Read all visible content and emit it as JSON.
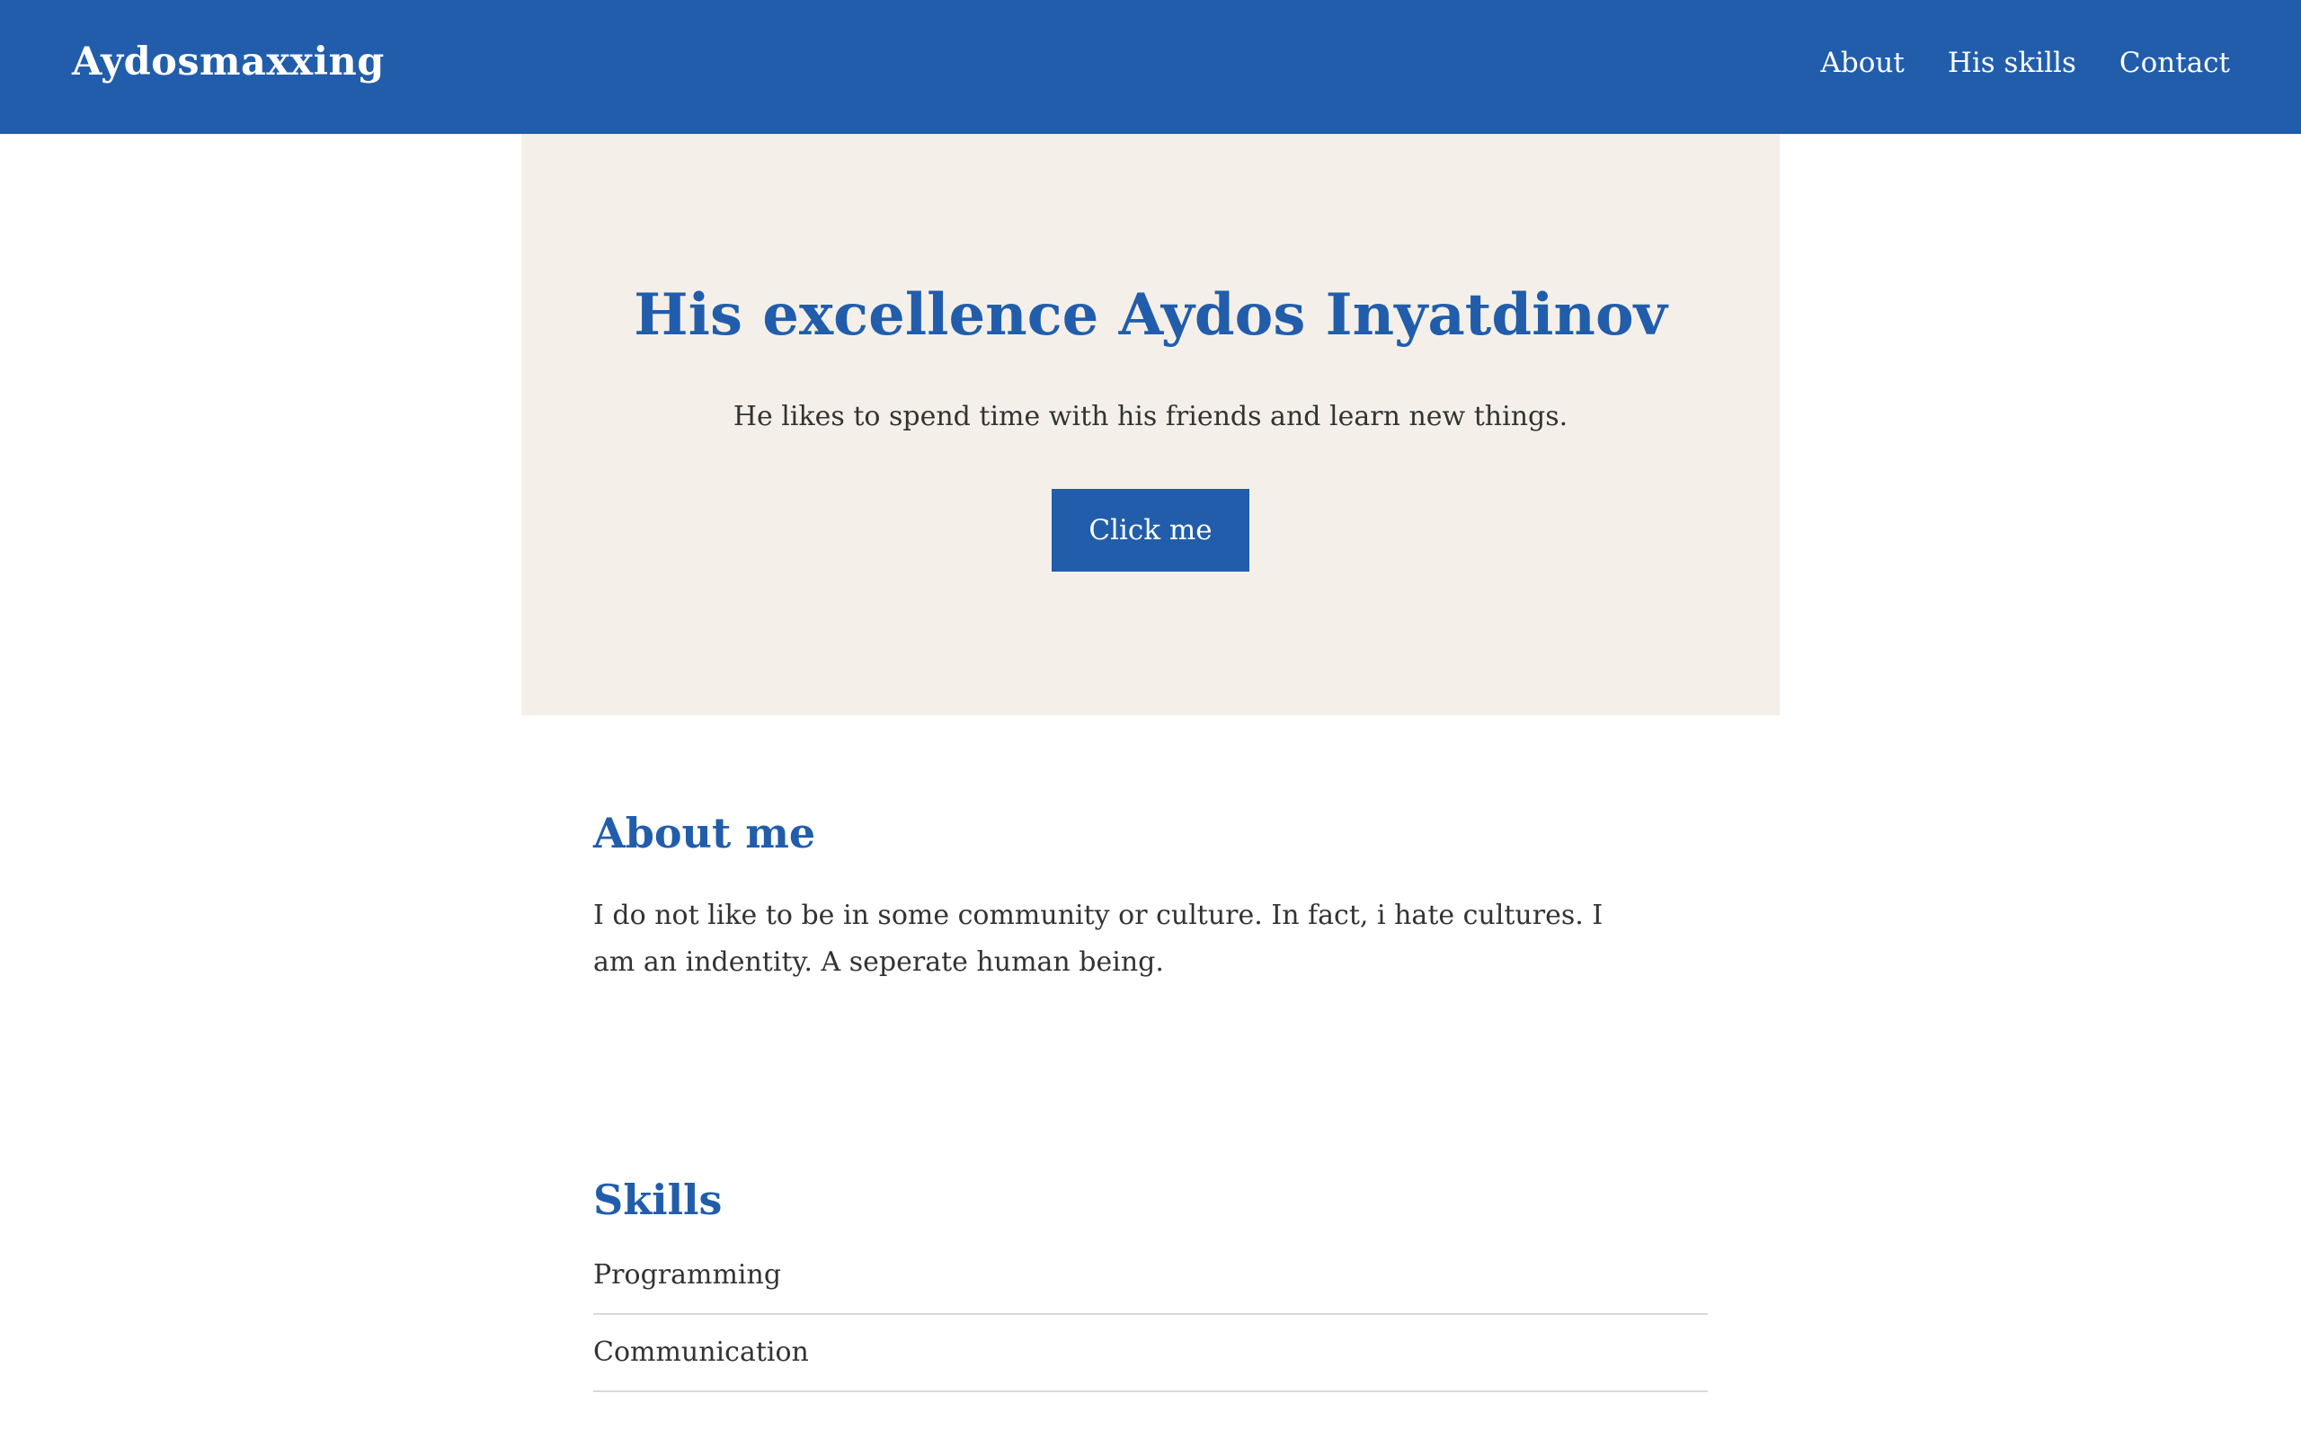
{
  "header": {
    "brand": "Aydosmaxxing",
    "nav": [
      {
        "label": "About"
      },
      {
        "label": "His skills"
      },
      {
        "label": "Contact"
      }
    ]
  },
  "hero": {
    "title": "His excellence Aydos Inyatdinov",
    "subtitle": "He likes to spend time with his friends and learn new things.",
    "button_label": "Click me"
  },
  "about": {
    "heading": "About me",
    "body": "I do not like to be in some community or culture. In fact, i hate cultures. I am an indentity. A seperate human being."
  },
  "skills": {
    "heading": "Skills",
    "items": [
      {
        "label": "Programming"
      },
      {
        "label": "Communication"
      }
    ]
  },
  "colors": {
    "primary": "#215dab",
    "hero_background": "#f4f0e9",
    "text": "#333333",
    "divider": "#d9d9d9"
  }
}
